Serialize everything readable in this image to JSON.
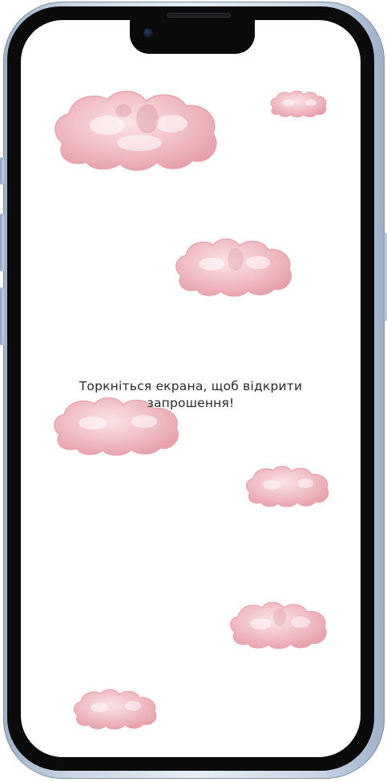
{
  "device": {
    "model_icon": "iphone-frame",
    "frame_color": "#c9d6e6",
    "screen_color": "#ffffff"
  },
  "screen": {
    "prompt_text": "Торкніться екрана, щоб відкрити запрошення!"
  },
  "decor": {
    "cloud_icon": "watercolor-cloud-icon",
    "cloud_color": "#f0b9c1"
  }
}
